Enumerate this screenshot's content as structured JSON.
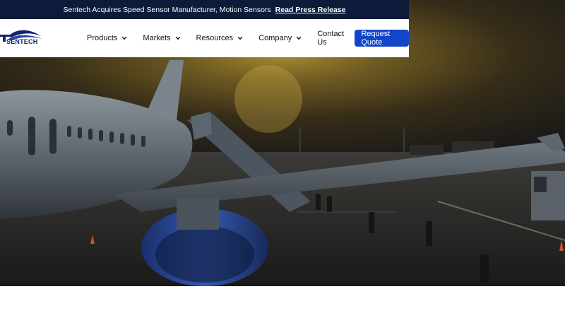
{
  "announcement": {
    "text": "Sentech Acquires Speed Sensor Manufacturer, Motion Sensors",
    "link_label": "Read Press Release"
  },
  "brand": {
    "name": "SENTECH",
    "primary_color": "#15246b",
    "accent_color": "#1246c8"
  },
  "nav": {
    "items": [
      {
        "label": "Products",
        "icon": "chevron-down-icon"
      },
      {
        "label": "Markets",
        "icon": "chevron-down-icon"
      },
      {
        "label": "Resources",
        "icon": "chevron-down-icon"
      },
      {
        "label": "Company",
        "icon": "chevron-down-icon"
      },
      {
        "label": "Contact Us"
      }
    ],
    "cta_label": "Request Quote"
  }
}
